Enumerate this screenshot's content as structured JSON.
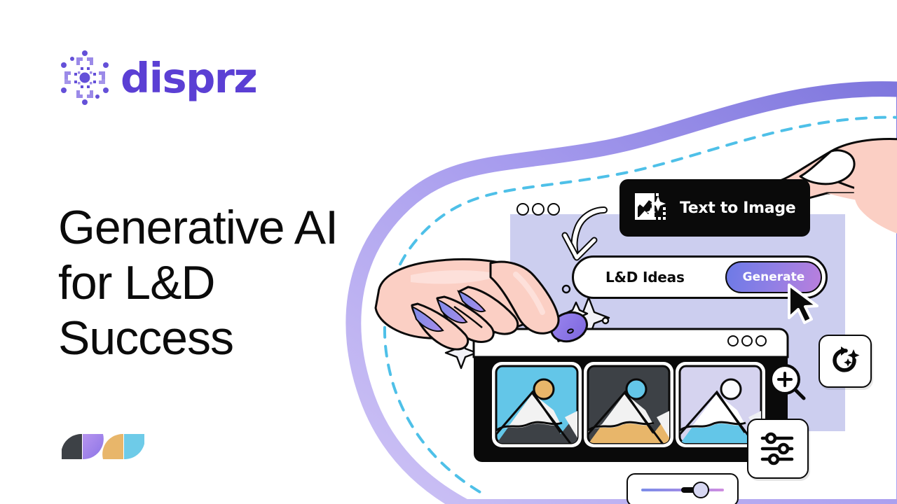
{
  "brand": {
    "name": "disprz",
    "mark_icon": "disprz-particle-mark",
    "color": "#5b3fd4",
    "accent_light": "#9b8ae8"
  },
  "headline": {
    "text": "Generative AI\nfor L&D\nSuccess",
    "color": "#0b0b0b"
  },
  "footer_mark": {
    "icon": "disprz-quarter-circles-mark",
    "colors": [
      "#3d4146",
      "#a987e8",
      "#e8b66a",
      "#6ecbe8"
    ]
  },
  "illustration": {
    "name": "text-to-image-generation-scene",
    "background": "#ffffff",
    "blob": {
      "ribbon_gradient_from": "#cfc4f5",
      "ribbon_gradient_to": "#7e76dd",
      "dashed_outline_color": "#4ec0e8"
    },
    "panel": {
      "name": "app-window-panel",
      "fill": "#ccceef",
      "window_dots": 3
    },
    "tti_card": {
      "label": "Text to Image",
      "icon": "image-sparkle-icon",
      "background": "#0a0a0a",
      "text_color": "#ffffff"
    },
    "prompt_bar": {
      "value": "L&D Ideas",
      "placeholder": "L&D Ideas",
      "button_label": "Generate",
      "button_gradient_from": "#6d7ae6",
      "button_gradient_to": "#b97fdd",
      "cursor_icon": "mouse-pointer-icon"
    },
    "arrow": {
      "icon": "curved-down-arrow-icon",
      "color": "#ffffff"
    },
    "hands": [
      {
        "name": "hand-holding-stylus",
        "skin": "#fbcfc4",
        "stylus_color": "#8f7ae8"
      },
      {
        "name": "pinching-hand",
        "skin": "#fbcfc4"
      }
    ],
    "results_window": {
      "name": "generated-results-window",
      "titlebar": "#ffffff",
      "body": "#0a0a0a",
      "window_dots": 3,
      "thumbnails": [
        {
          "name": "thumb-1",
          "sky": "#63c6e8",
          "sun": "#e8b66a",
          "mountain": "#3d4146",
          "snow": "#f2f2f2"
        },
        {
          "name": "thumb-2",
          "sky": "#3d4146",
          "sun": "#63c6e8",
          "mountain": "#e8b66a",
          "snow": "#f2f2f2"
        },
        {
          "name": "thumb-3",
          "sky": "#d5d3ef",
          "sun": "#fbfbff",
          "mountain": "#63c6e8",
          "snow": "#ffffff"
        }
      ]
    },
    "tools": [
      {
        "name": "zoom-in-magnifier-icon",
        "label": "Zoom in"
      },
      {
        "name": "regenerate-sparkle-icon",
        "label": "Regenerate"
      },
      {
        "name": "sliders-settings-icon",
        "label": "Settings"
      }
    ],
    "slider": {
      "name": "intensity-slider",
      "value_pct": 72,
      "track_gradient_from": "#7b8ce8",
      "track_gradient_to": "#cf8de0",
      "knob_fill": "#d7d7f2"
    },
    "sparkles": 4
  }
}
